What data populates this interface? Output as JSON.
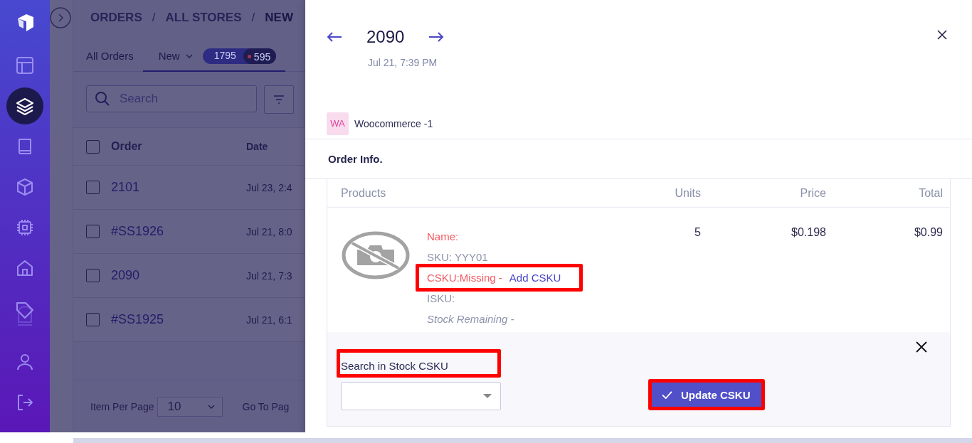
{
  "sidebar": {
    "items": [
      {
        "kind": "layout",
        "selected": false
      },
      {
        "kind": "layers",
        "selected": true
      },
      {
        "kind": "book",
        "selected": false
      },
      {
        "kind": "box",
        "selected": false
      },
      {
        "kind": "chip",
        "selected": false
      },
      {
        "kind": "home",
        "selected": false
      },
      {
        "kind": "tag",
        "selected": false
      },
      {
        "kind": "user",
        "selected": false
      },
      {
        "kind": "logout",
        "selected": false
      }
    ]
  },
  "breadcrumb": [
    {
      "label": "ORDERS",
      "current": false
    },
    {
      "label": "ALL STORES",
      "current": false
    },
    {
      "label": "NEW",
      "current": true
    }
  ],
  "breadcrumb_separators": [
    "/",
    "/"
  ],
  "tabs": [
    {
      "label": "All Orders",
      "selected": false
    },
    {
      "label": "New",
      "selected": true,
      "count": "1795",
      "alert_count": "595"
    }
  ],
  "search": {
    "placeholder": "Search"
  },
  "orders_table": {
    "columns": [
      "Order",
      "Date"
    ],
    "all_checked": false,
    "rows": [
      {
        "order": "2101",
        "date": "Jul 23, 2:4",
        "checked": false
      },
      {
        "order": "#SS1926",
        "date": "Jul 21, 8:0",
        "checked": false
      },
      {
        "order": "2090",
        "date": "Jul 21, 7:3",
        "checked": false
      },
      {
        "order": "#SS1925",
        "date": "Jul 21, 6:1",
        "checked": false
      }
    ]
  },
  "pager": {
    "label": "Item Per Page",
    "value": "10",
    "goto_label": "Go To Pag"
  },
  "drawer": {
    "title": "2090",
    "date": "Jul 21, 7:39 PM",
    "store": {
      "badge": "WA",
      "name": "Woocommerce -1"
    },
    "section_title": "Order Info.",
    "products": {
      "columns": [
        "Products",
        "Units",
        "Price",
        "Total"
      ],
      "items": [
        {
          "name_label": "Name:",
          "sku": "SKU: YYY01",
          "csku": "CSKU:Missing -",
          "add_link": "Add CSKU",
          "csku_highlighted": true,
          "isku": "ISKU:",
          "stock": "Stock Remaining -",
          "units": "5",
          "price": "$0.198",
          "total": "$0.99"
        }
      ]
    },
    "csku_editor": {
      "label": "Search in Stock CSKU",
      "label_highlighted": true,
      "button": "Update CSKU",
      "button_highlighted": true
    }
  }
}
